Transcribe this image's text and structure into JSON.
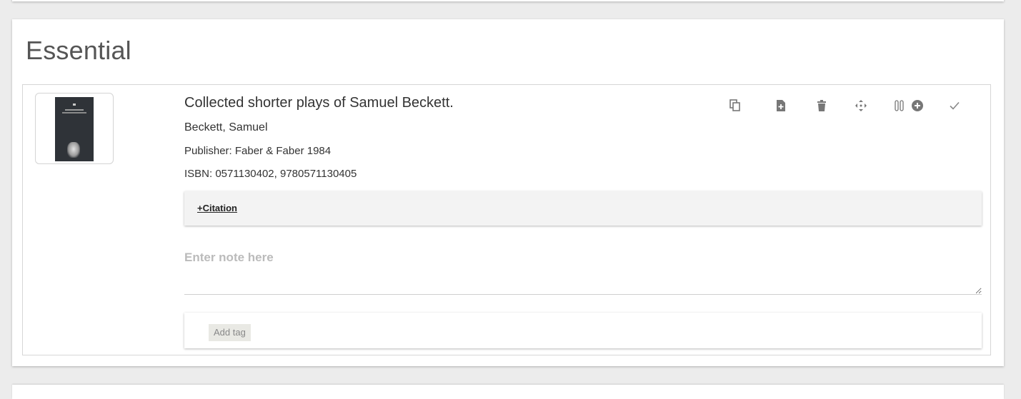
{
  "section": {
    "title": "Essential"
  },
  "item": {
    "title": "Collected shorter plays of Samuel Beckett.",
    "author": "Beckett, Samuel",
    "publisher": "Publisher: Faber & Faber 1984",
    "isbn": "ISBN: 0571130402, 9780571130405",
    "citation_label": "+Citation",
    "note_placeholder": "Enter note here",
    "add_tag_label": "Add tag"
  },
  "toolbar": {
    "icons": [
      "copy-icon",
      "add-file-icon",
      "delete-icon",
      "move-icon",
      "link-add-icon",
      "check-icon"
    ],
    "icon_color": "#777777"
  }
}
